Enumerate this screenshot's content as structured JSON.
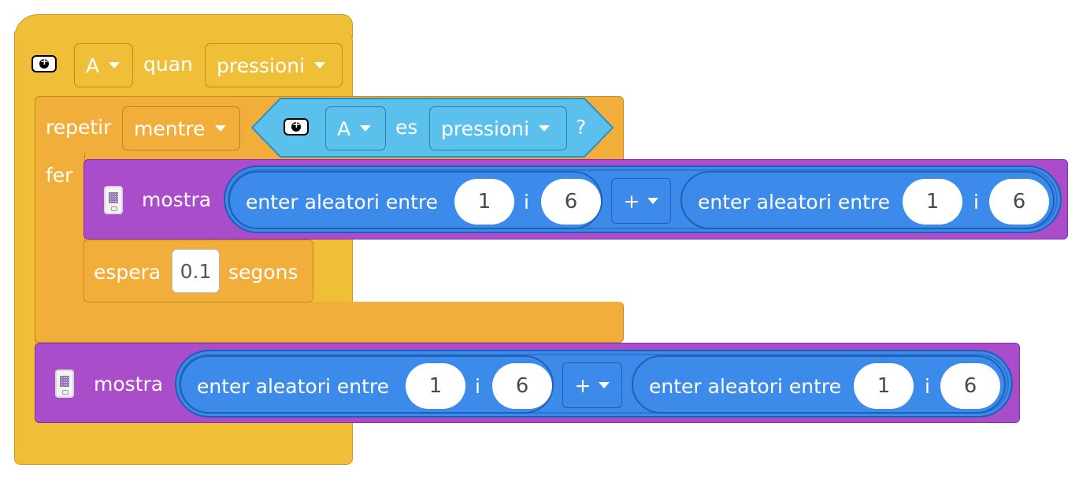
{
  "event_block": {
    "button": "A",
    "quan": "quan",
    "action": "pressioni"
  },
  "loop_block": {
    "repetir": "repetir",
    "mode": "mentre",
    "fer": "fer",
    "condition": {
      "button": "A",
      "es": "es",
      "action": "pressioni",
      "question": "?"
    }
  },
  "show_block_1": {
    "label": "mostra",
    "left": {
      "label": "enter aleatori entre",
      "from": "1",
      "i": "i",
      "to": "6"
    },
    "op": "+",
    "right": {
      "label": "enter aleatori entre",
      "from": "1",
      "i": "i",
      "to": "6"
    }
  },
  "wait_block": {
    "label": "espera",
    "value": "0.1",
    "unit": "segons"
  },
  "show_block_2": {
    "label": "mostra",
    "left": {
      "label": "enter aleatori entre",
      "from": "1",
      "i": "i",
      "to": "6"
    },
    "op": "+",
    "right": {
      "label": "enter aleatori entre",
      "from": "1",
      "i": "i",
      "to": "6"
    }
  },
  "colors": {
    "hat": "#EFBF38",
    "control": "#F2AE3B",
    "display": "#A94DCB",
    "math": "#3C8BEA",
    "sensing": "#5BC0EB"
  }
}
